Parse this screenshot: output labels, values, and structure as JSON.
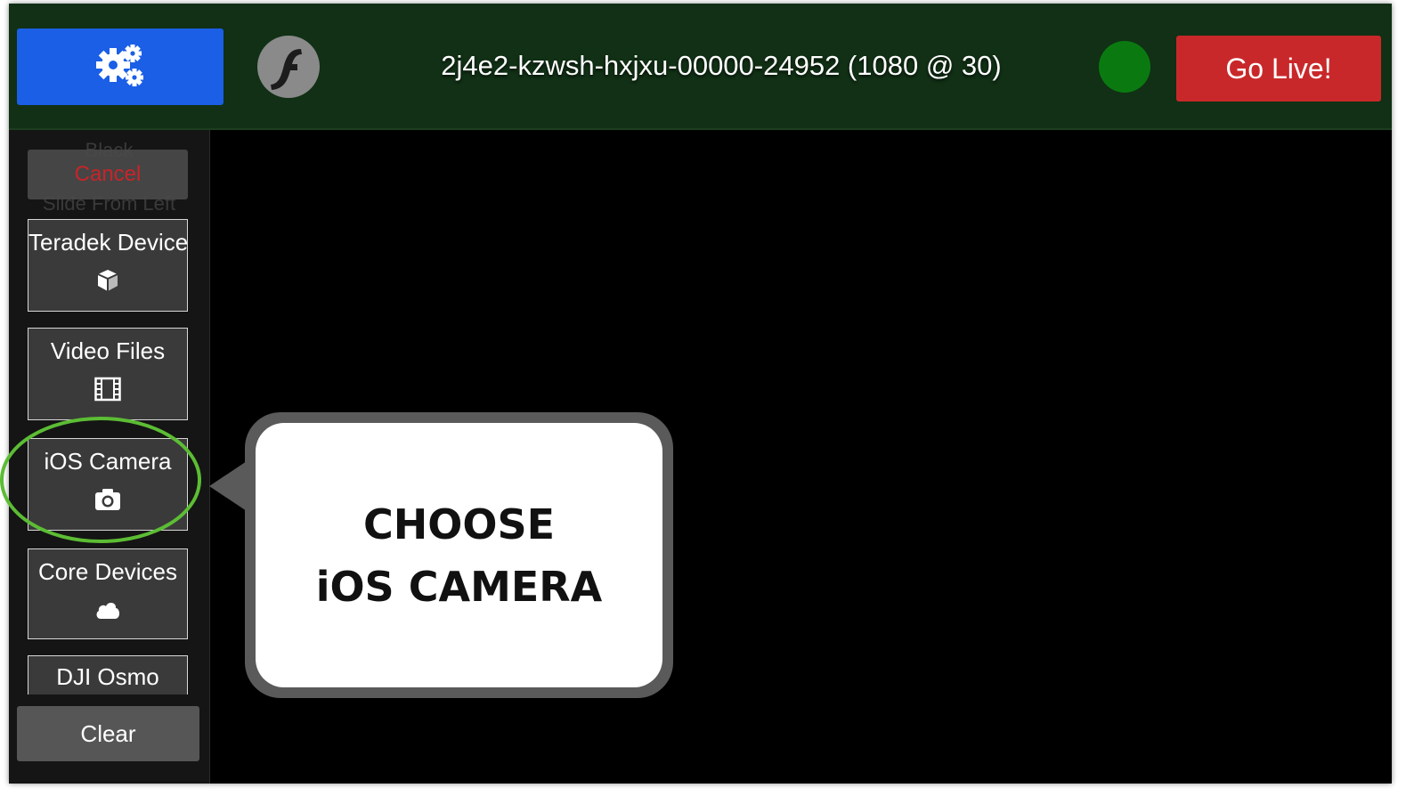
{
  "header": {
    "stream_id": "2j4e2-kzwsh-hxjxu-00000-24952  (1080 @ 30)",
    "go_live_label": "Go Live!",
    "settings_icon": "gears-icon",
    "logo_icon": "flash-logo",
    "status_color": "#0a7a10"
  },
  "sidebar": {
    "ghost_texts": [
      "Black",
      "Slide From Left"
    ],
    "cancel_label": "Cancel",
    "sources": [
      {
        "label": "Teradek Device",
        "icon": "cube-icon"
      },
      {
        "label": "Video Files",
        "icon": "film-icon"
      },
      {
        "label": "iOS Camera",
        "icon": "camera-icon"
      },
      {
        "label": "Core Devices",
        "icon": "cloud-icon"
      },
      {
        "label": "DJI Osmo",
        "icon": ""
      }
    ],
    "clear_label": "Clear"
  },
  "callout": {
    "line1": "CHOOSE",
    "line2": "iOS CAMERA"
  },
  "colors": {
    "topbar": "#113015",
    "settings_button": "#1a5fe6",
    "go_live_button": "#c9282a",
    "highlight": "#5cbd34"
  }
}
